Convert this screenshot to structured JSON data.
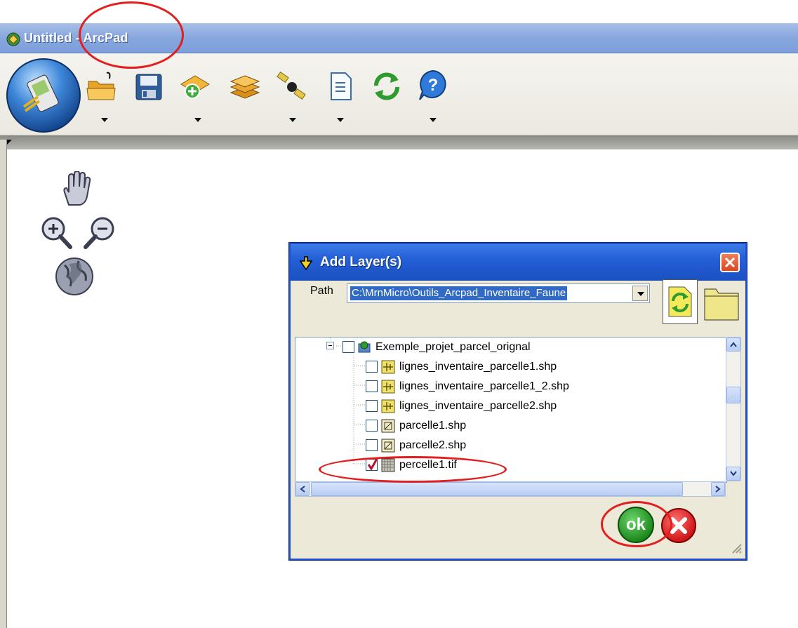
{
  "window": {
    "title": "Untitled - ArcPad"
  },
  "toolbar": {
    "buttons": [
      "arcpad-menu",
      "open-folder",
      "save",
      "add-layer",
      "layers",
      "gps",
      "page",
      "refresh",
      "help"
    ]
  },
  "map_tools": [
    "pan-hand",
    "zoom-in",
    "zoom-out",
    "full-extent-globe"
  ],
  "dialog": {
    "title": "Add Layer(s)",
    "path_label": "Path",
    "path_value": "C:\\MrnMicro\\Outils_Arcpad_Inventaire_Faune",
    "tree": {
      "folder": {
        "label": "Exemple_projet_parcel_orignal",
        "checked": false
      },
      "files": [
        {
          "label": "lignes_inventaire_parcelle1.shp",
          "type": "line-shapefile",
          "checked": false
        },
        {
          "label": "lignes_inventaire_parcelle1_2.shp",
          "type": "line-shapefile",
          "checked": false
        },
        {
          "label": "lignes_inventaire_parcelle2.shp",
          "type": "line-shapefile",
          "checked": false
        },
        {
          "label": "parcelle1.shp",
          "type": "polygon-shapefile",
          "checked": false
        },
        {
          "label": "parcelle2.shp",
          "type": "polygon-shapefile",
          "checked": false
        },
        {
          "label": "percelle1.tif",
          "type": "raster",
          "checked": true
        }
      ]
    },
    "ok_label": "ok"
  },
  "colors": {
    "title_bar": "#86a6dd",
    "dialog_title_bar": "#2460d6",
    "dialog_body": "#ece9d8",
    "annotation_red": "#e21e1e",
    "selection": "#316ac5"
  }
}
